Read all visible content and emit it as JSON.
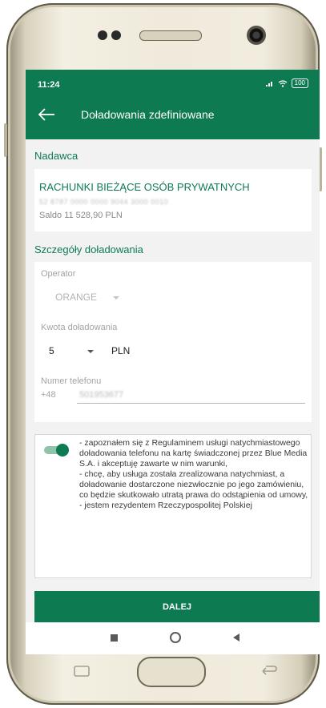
{
  "status_bar": {
    "time": "11:24",
    "signal_icon": "signal-icon",
    "wifi_icon": "wifi-icon",
    "battery": "100"
  },
  "app_bar": {
    "back_icon": "arrow-left-icon",
    "title": "Doładowania zdefiniowane",
    "color": "#0d7a52"
  },
  "sender": {
    "section_title": "Nadawca",
    "account_name": "RACHUNKI BIEŻĄCE OSÓB PRYWATNYCH",
    "account_number": "52 8787 0000 0000 9044 3000 0010",
    "balance": "Saldo  11 528,90 PLN"
  },
  "details": {
    "section_title": "Szczegóły doładowania",
    "operator_label": "Operator",
    "operator_value": "ORANGE",
    "amount_label": "Kwota doładowania",
    "amount_value": "5",
    "currency": "PLN",
    "phone_label": "Numer telefonu",
    "phone_prefix": "+48",
    "phone_value": "501953677"
  },
  "consent": {
    "toggle_on": true,
    "line1": "- zapoznałem się z Regulaminem usługi natychmiastowego doładowania telefonu na kartę świadczonej przez Blue Media S.A. i akceptuję zawarte w nim warunki,",
    "line2": "- chcę, aby usługa została zrealizowana natychmiast, a doładowanie dostarczone niezwłocznie po jego zamówieniu, co będzie skutkowało utratą prawa do odstąpienia od umowy,",
    "line3": "- jestem rezydentem Rzeczypospolitej Polskiej"
  },
  "next_button": "DALEJ",
  "nav": {
    "recents_icon": "square-icon",
    "home_icon": "circle-icon",
    "back_icon": "triangle-back-icon"
  }
}
